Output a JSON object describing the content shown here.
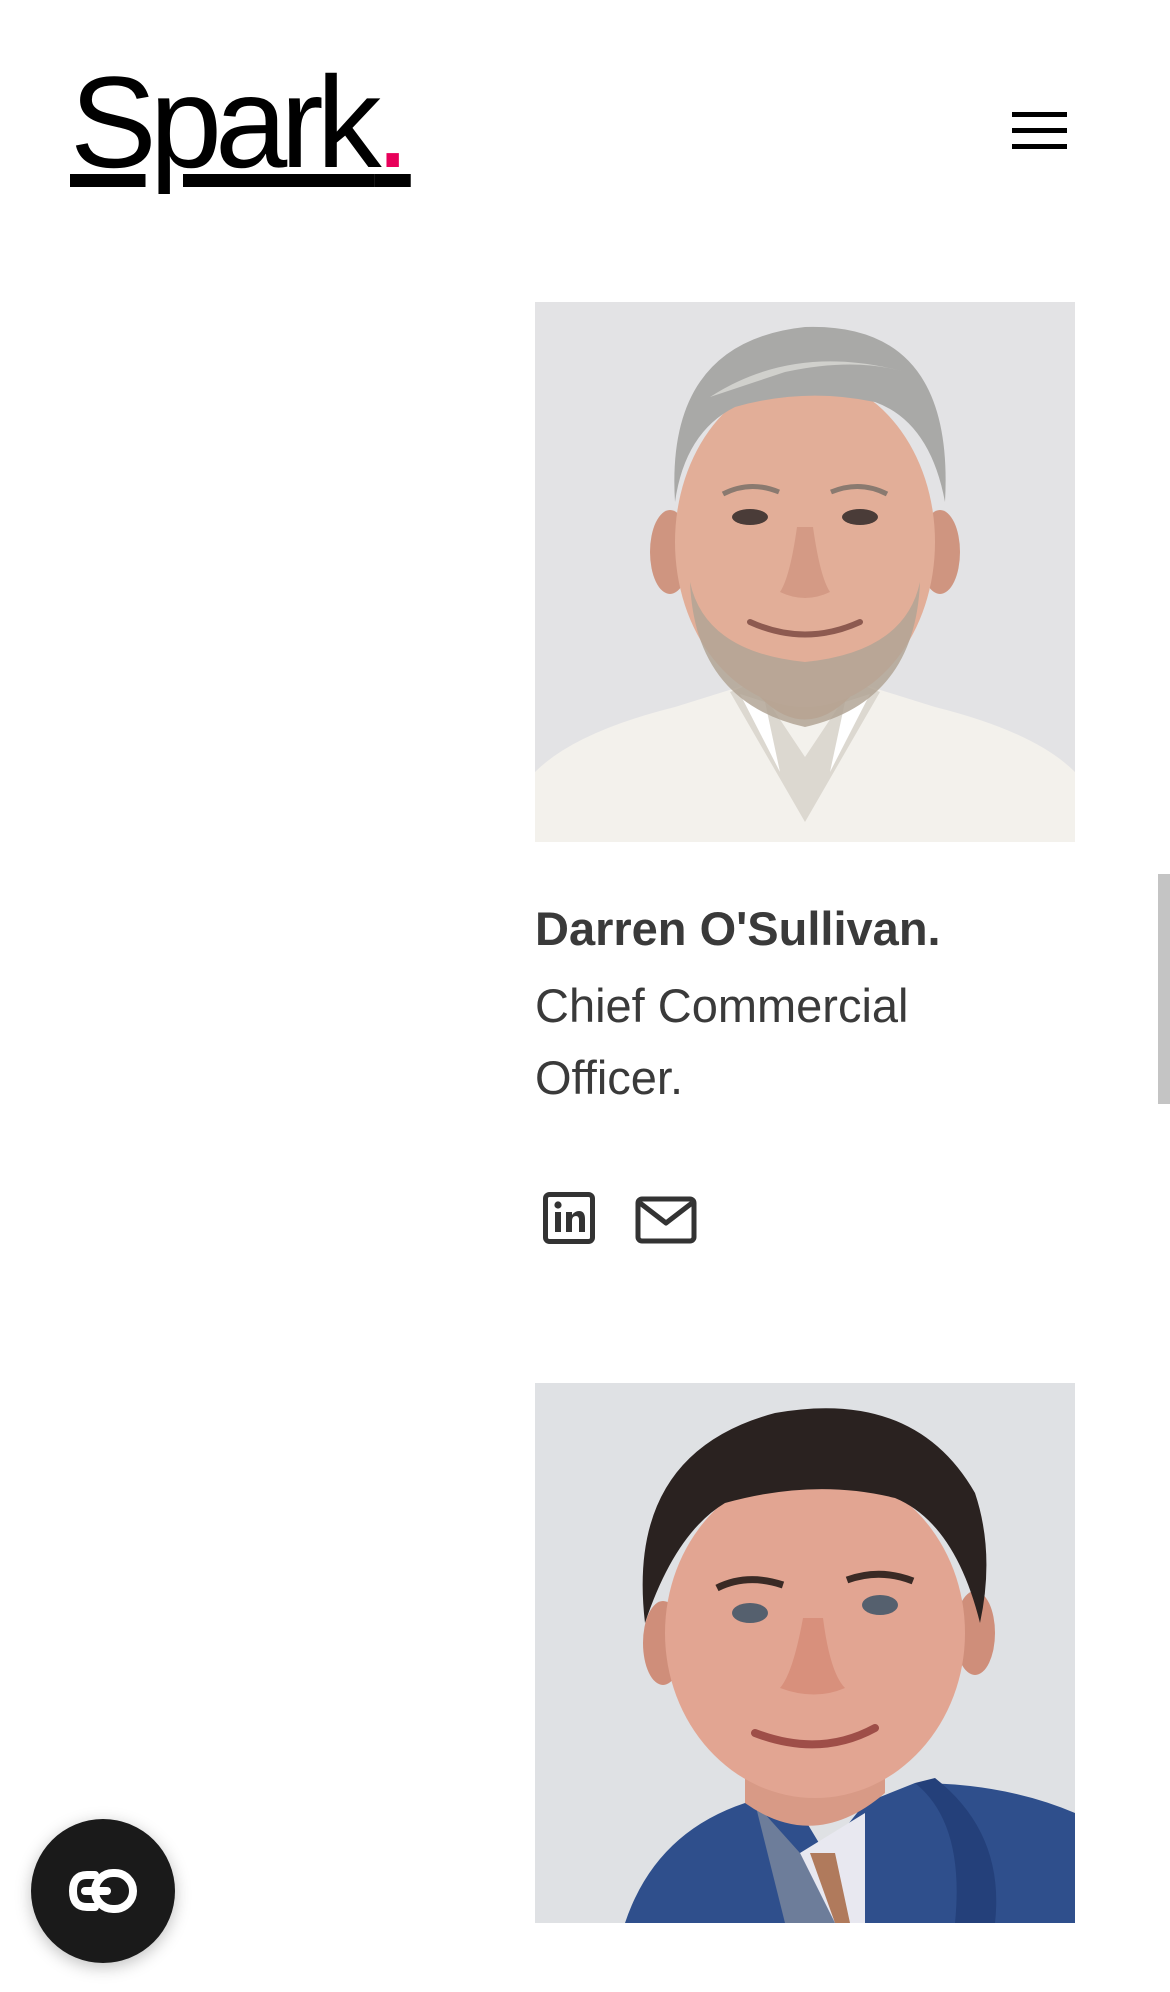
{
  "header": {
    "logo_text": "Spark",
    "logo_dot": ".",
    "brand_color": "#e8005a",
    "menu_icon": "hamburger-icon",
    "menu_label": "Menu"
  },
  "team": [
    {
      "name": "Darren O'Sullivan.",
      "role": "Chief Commercial Officer.",
      "photo": "portrait-grey-hair-white-shirt",
      "links": [
        {
          "icon": "linkedin-icon",
          "label": "LinkedIn"
        },
        {
          "icon": "mail-icon",
          "label": "Email"
        }
      ]
    },
    {
      "name": "",
      "role": "",
      "photo": "portrait-dark-hair-blue-jacket",
      "links": []
    }
  ],
  "accessibility": {
    "icon": "accessibility-toggle-icon",
    "label": "Accessibility"
  },
  "colors": {
    "text": "#3a3a3a",
    "logo": "#000000",
    "accent": "#e8005a",
    "photo_background": "#e6e6e6"
  }
}
